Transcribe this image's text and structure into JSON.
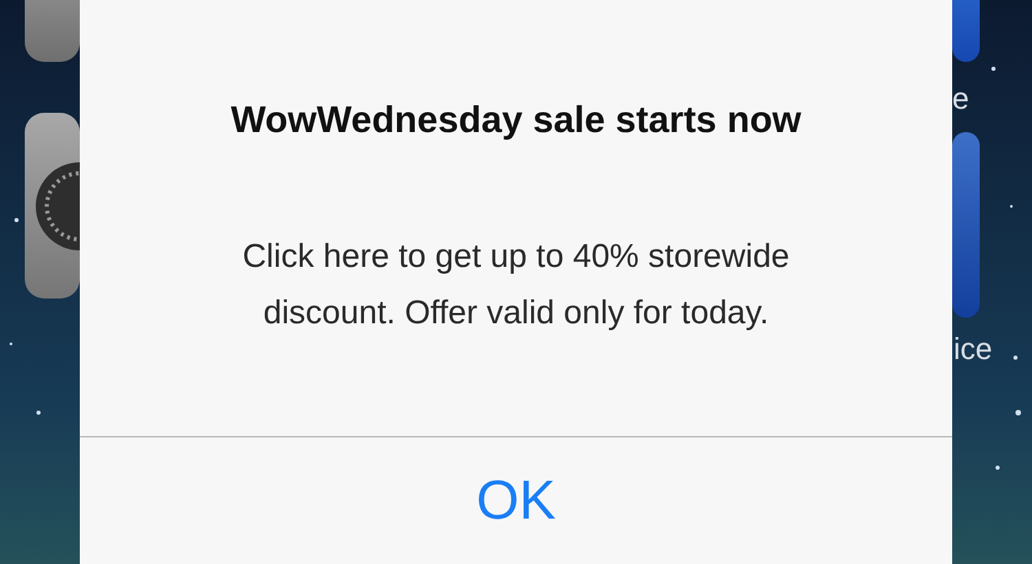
{
  "home_screen": {
    "right_labels": [
      "e",
      "ice"
    ]
  },
  "alert": {
    "title": "WowWednesday sale starts now",
    "message": "Click here to get up to 40% storewide discount. Offer valid only for today.",
    "buttons": [
      {
        "label": "OK"
      }
    ]
  }
}
